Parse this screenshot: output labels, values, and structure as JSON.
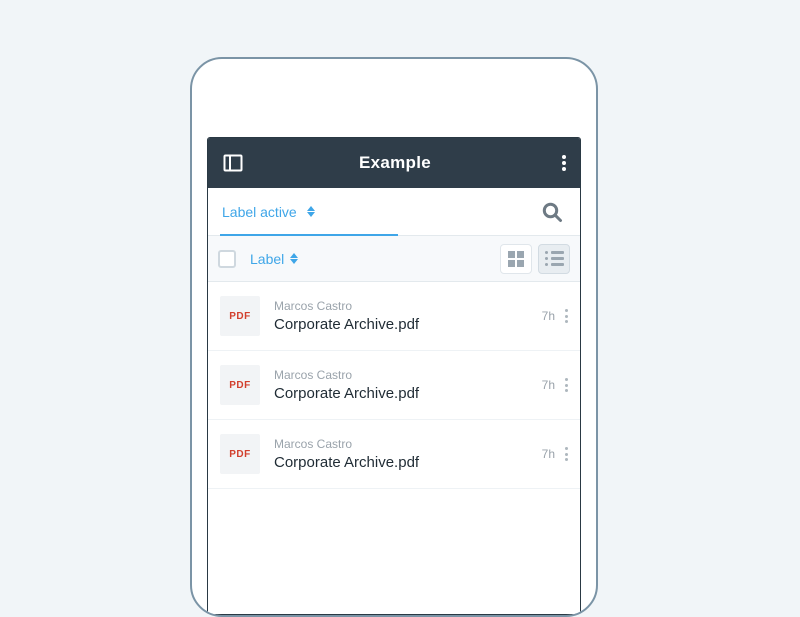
{
  "appbar": {
    "title": "Example"
  },
  "filter": {
    "active_label": "Label active"
  },
  "listhead": {
    "column_label": "Label"
  },
  "file_icon_label": "PDF",
  "files": [
    {
      "author": "Marcos Castro",
      "name": "Corporate Archive.pdf",
      "time": "7h"
    },
    {
      "author": "Marcos Castro",
      "name": "Corporate Archive.pdf",
      "time": "7h"
    },
    {
      "author": "Marcos Castro",
      "name": "Corporate Archive.pdf",
      "time": "7h"
    }
  ]
}
